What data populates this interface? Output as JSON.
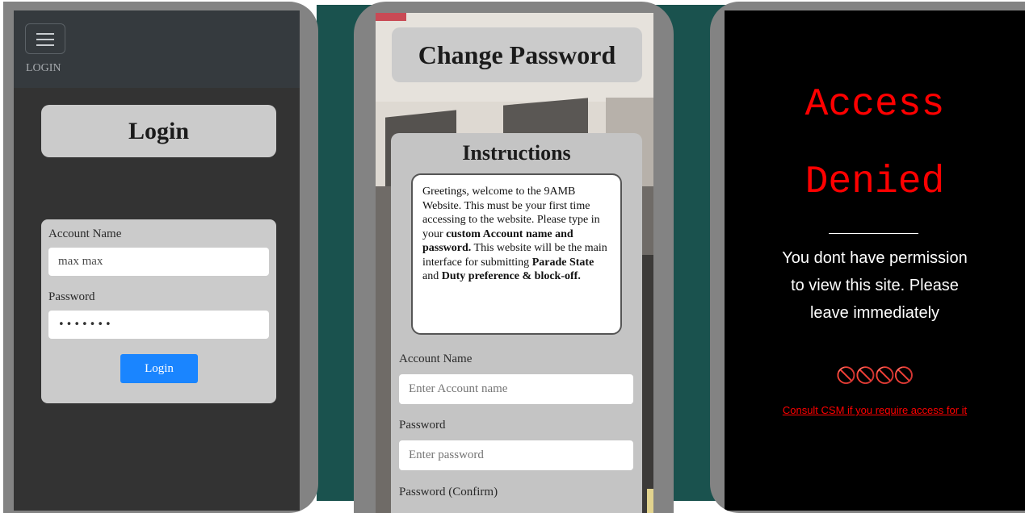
{
  "phone1": {
    "nav": {
      "menu_icon": "hamburger-menu-icon",
      "label": "LOGIN"
    },
    "title": "Login",
    "form": {
      "account_label": "Account Name",
      "account_value": "max max",
      "password_label": "Password",
      "password_value": "•••••••",
      "submit_label": "Login"
    },
    "colors": {
      "button": "#1a85ff",
      "screen": "#333333"
    }
  },
  "phone2": {
    "title": "Change Password",
    "instructions": {
      "heading": "Instructions",
      "text_1": "Greetings, welcome to the 9AMB Website. This must be your first time accessing to the website. Please type in your ",
      "bold_1": "custom Account name and password.",
      "text_2": " This website will be the main interface for submitting ",
      "bold_2": "Parade State",
      "text_3": " and ",
      "bold_3": "Duty preference & block-off."
    },
    "form": {
      "account_label": "Account Name",
      "account_placeholder": "Enter Account name",
      "password_label": "Password",
      "password_placeholder": "Enter password",
      "confirm_label": "Password (Confirm)"
    }
  },
  "phone3": {
    "heading_line1": "Access",
    "heading_line2": "Denied",
    "message": "You dont have permission to view this site. Please leave immediately",
    "icons": "🚫🚫🚫🚫",
    "link": "Consult CSM if you require access for it",
    "colors": {
      "accent": "#ff0000",
      "background": "#000000"
    }
  }
}
